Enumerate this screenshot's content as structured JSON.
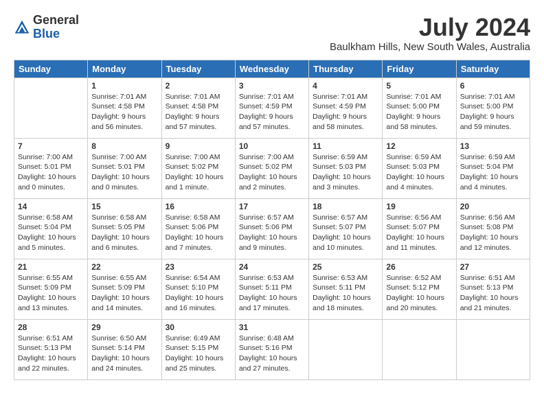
{
  "header": {
    "logo_general": "General",
    "logo_blue": "Blue",
    "month_year": "July 2024",
    "location": "Baulkham Hills, New South Wales, Australia"
  },
  "days_of_week": [
    "Sunday",
    "Monday",
    "Tuesday",
    "Wednesday",
    "Thursday",
    "Friday",
    "Saturday"
  ],
  "weeks": [
    [
      {
        "num": "",
        "empty": true
      },
      {
        "num": "1",
        "sunrise": "7:01 AM",
        "sunset": "4:58 PM",
        "daylight": "9 hours and 56 minutes."
      },
      {
        "num": "2",
        "sunrise": "7:01 AM",
        "sunset": "4:58 PM",
        "daylight": "9 hours and 57 minutes."
      },
      {
        "num": "3",
        "sunrise": "7:01 AM",
        "sunset": "4:59 PM",
        "daylight": "9 hours and 57 minutes."
      },
      {
        "num": "4",
        "sunrise": "7:01 AM",
        "sunset": "4:59 PM",
        "daylight": "9 hours and 58 minutes."
      },
      {
        "num": "5",
        "sunrise": "7:01 AM",
        "sunset": "5:00 PM",
        "daylight": "9 hours and 58 minutes."
      },
      {
        "num": "6",
        "sunrise": "7:01 AM",
        "sunset": "5:00 PM",
        "daylight": "9 hours and 59 minutes."
      }
    ],
    [
      {
        "num": "7",
        "sunrise": "7:00 AM",
        "sunset": "5:01 PM",
        "daylight": "10 hours and 0 minutes."
      },
      {
        "num": "8",
        "sunrise": "7:00 AM",
        "sunset": "5:01 PM",
        "daylight": "10 hours and 0 minutes."
      },
      {
        "num": "9",
        "sunrise": "7:00 AM",
        "sunset": "5:02 PM",
        "daylight": "10 hours and 1 minute."
      },
      {
        "num": "10",
        "sunrise": "7:00 AM",
        "sunset": "5:02 PM",
        "daylight": "10 hours and 2 minutes."
      },
      {
        "num": "11",
        "sunrise": "6:59 AM",
        "sunset": "5:03 PM",
        "daylight": "10 hours and 3 minutes."
      },
      {
        "num": "12",
        "sunrise": "6:59 AM",
        "sunset": "5:03 PM",
        "daylight": "10 hours and 4 minutes."
      },
      {
        "num": "13",
        "sunrise": "6:59 AM",
        "sunset": "5:04 PM",
        "daylight": "10 hours and 4 minutes."
      }
    ],
    [
      {
        "num": "14",
        "sunrise": "6:58 AM",
        "sunset": "5:04 PM",
        "daylight": "10 hours and 5 minutes."
      },
      {
        "num": "15",
        "sunrise": "6:58 AM",
        "sunset": "5:05 PM",
        "daylight": "10 hours and 6 minutes."
      },
      {
        "num": "16",
        "sunrise": "6:58 AM",
        "sunset": "5:06 PM",
        "daylight": "10 hours and 7 minutes."
      },
      {
        "num": "17",
        "sunrise": "6:57 AM",
        "sunset": "5:06 PM",
        "daylight": "10 hours and 9 minutes."
      },
      {
        "num": "18",
        "sunrise": "6:57 AM",
        "sunset": "5:07 PM",
        "daylight": "10 hours and 10 minutes."
      },
      {
        "num": "19",
        "sunrise": "6:56 AM",
        "sunset": "5:07 PM",
        "daylight": "10 hours and 11 minutes."
      },
      {
        "num": "20",
        "sunrise": "6:56 AM",
        "sunset": "5:08 PM",
        "daylight": "10 hours and 12 minutes."
      }
    ],
    [
      {
        "num": "21",
        "sunrise": "6:55 AM",
        "sunset": "5:09 PM",
        "daylight": "10 hours and 13 minutes."
      },
      {
        "num": "22",
        "sunrise": "6:55 AM",
        "sunset": "5:09 PM",
        "daylight": "10 hours and 14 minutes."
      },
      {
        "num": "23",
        "sunrise": "6:54 AM",
        "sunset": "5:10 PM",
        "daylight": "10 hours and 16 minutes."
      },
      {
        "num": "24",
        "sunrise": "6:53 AM",
        "sunset": "5:11 PM",
        "daylight": "10 hours and 17 minutes."
      },
      {
        "num": "25",
        "sunrise": "6:53 AM",
        "sunset": "5:11 PM",
        "daylight": "10 hours and 18 minutes."
      },
      {
        "num": "26",
        "sunrise": "6:52 AM",
        "sunset": "5:12 PM",
        "daylight": "10 hours and 20 minutes."
      },
      {
        "num": "27",
        "sunrise": "6:51 AM",
        "sunset": "5:13 PM",
        "daylight": "10 hours and 21 minutes."
      }
    ],
    [
      {
        "num": "28",
        "sunrise": "6:51 AM",
        "sunset": "5:13 PM",
        "daylight": "10 hours and 22 minutes."
      },
      {
        "num": "29",
        "sunrise": "6:50 AM",
        "sunset": "5:14 PM",
        "daylight": "10 hours and 24 minutes."
      },
      {
        "num": "30",
        "sunrise": "6:49 AM",
        "sunset": "5:15 PM",
        "daylight": "10 hours and 25 minutes."
      },
      {
        "num": "31",
        "sunrise": "6:48 AM",
        "sunset": "5:16 PM",
        "daylight": "10 hours and 27 minutes."
      },
      {
        "num": "",
        "empty": true
      },
      {
        "num": "",
        "empty": true
      },
      {
        "num": "",
        "empty": true
      }
    ]
  ],
  "labels": {
    "sunrise_prefix": "Sunrise: ",
    "sunset_prefix": "Sunset: ",
    "daylight_prefix": "Daylight: "
  }
}
